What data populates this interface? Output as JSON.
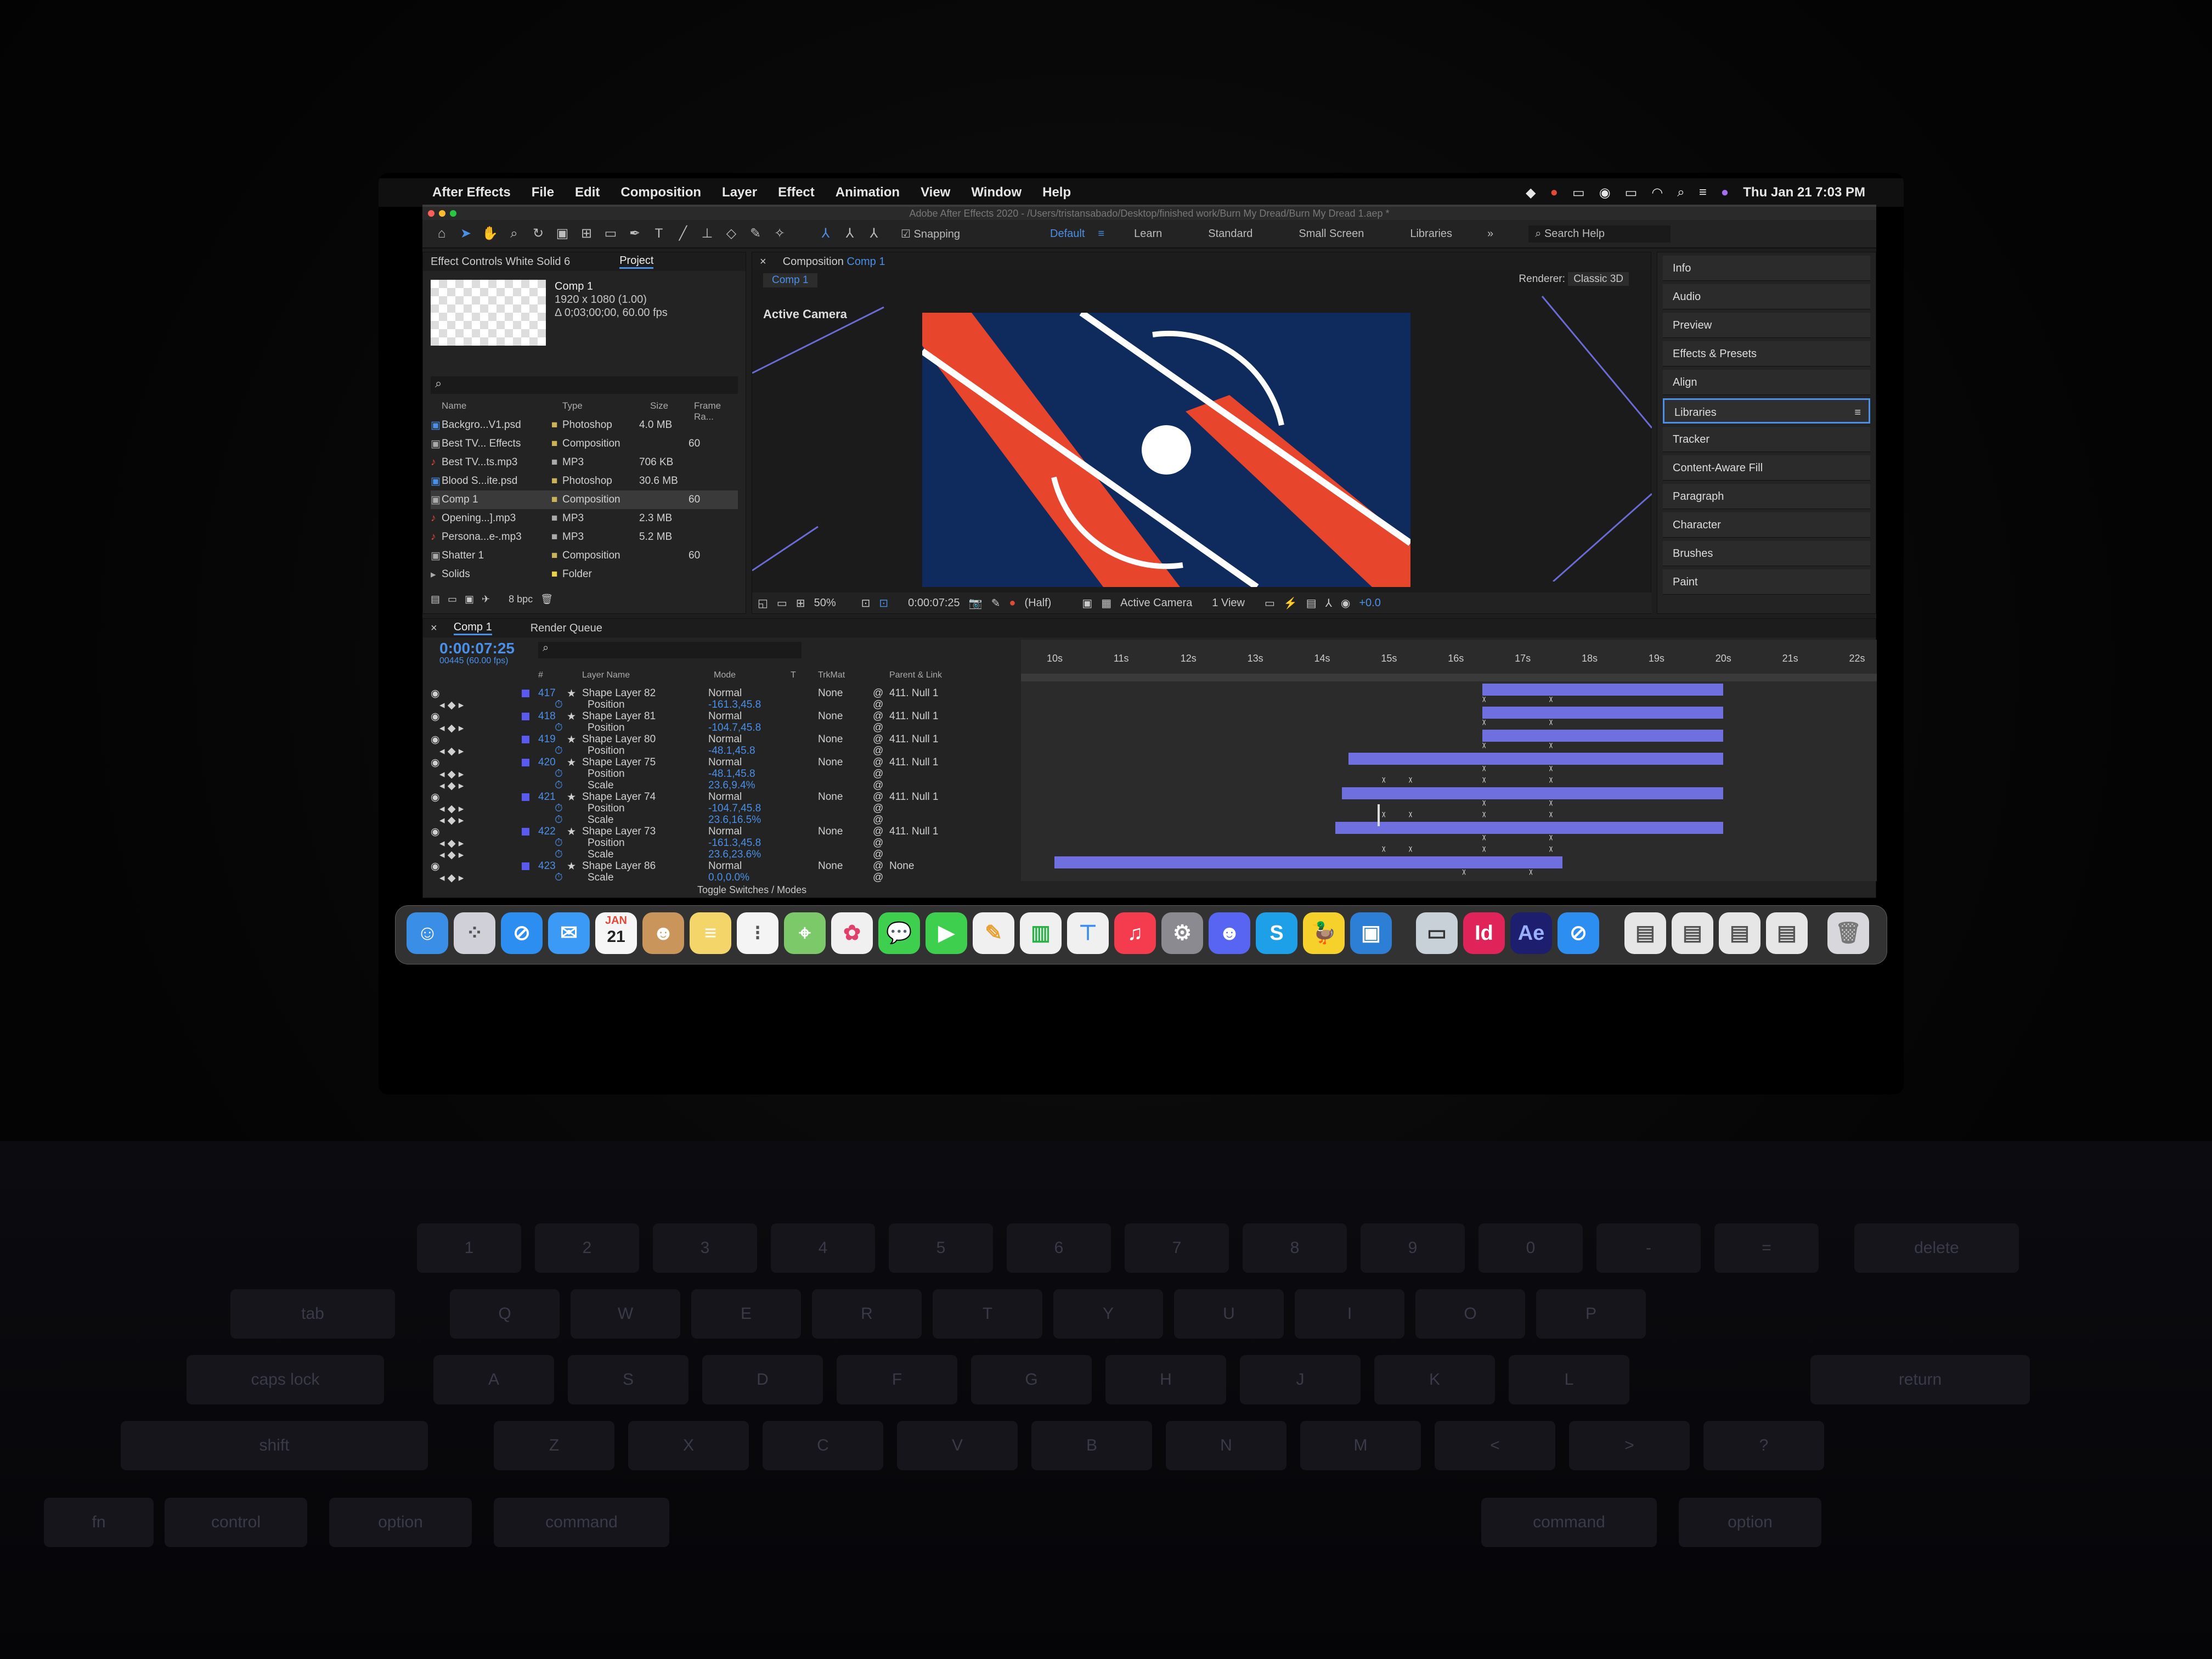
{
  "menubar": {
    "apple": "",
    "app": "After Effects",
    "items": [
      "File",
      "Edit",
      "Composition",
      "Layer",
      "Effect",
      "Animation",
      "View",
      "Window",
      "Help"
    ],
    "clock": "Thu Jan 21  7:03 PM"
  },
  "window": {
    "title": "Adobe After Effects 2020 - /Users/tristansabado/Desktop/finished work/Burn My Dread/Burn My Dread 1.aep *"
  },
  "toolbar": {
    "snapping": "Snapping",
    "workspaces": [
      "Default",
      "Learn",
      "Standard",
      "Small Screen",
      "Libraries"
    ],
    "active_workspace": "Default",
    "search_help": "Search Help"
  },
  "project_panel": {
    "tab_effect_controls": "Effect Controls White Solid 6",
    "tab_project": "Project",
    "comp_name": "Comp 1",
    "comp_info1": "1920 x 1080 (1.00)",
    "comp_info2": "Δ 0;03;00;00, 60.00 fps",
    "columns": {
      "name": "Name",
      "type": "Type",
      "size": "Size",
      "frame": "Frame Ra..."
    },
    "items": [
      {
        "name": "Backgro...V1.psd",
        "type": "Photoshop",
        "size": "4.0 MB",
        "frame": ""
      },
      {
        "name": "Best TV... Effects",
        "type": "Composition",
        "size": "",
        "frame": "60"
      },
      {
        "name": "Best TV...ts.mp3",
        "type": "MP3",
        "size": "706 KB",
        "frame": ""
      },
      {
        "name": "Blood S...ite.psd",
        "type": "Photoshop",
        "size": "30.6 MB",
        "frame": ""
      },
      {
        "name": "Comp 1",
        "type": "Composition",
        "size": "",
        "frame": "60"
      },
      {
        "name": "Opening...].mp3",
        "type": "MP3",
        "size": "2.3 MB",
        "frame": ""
      },
      {
        "name": "Persona...e-.mp3",
        "type": "MP3",
        "size": "5.2 MB",
        "frame": ""
      },
      {
        "name": "Shatter 1",
        "type": "Composition",
        "size": "",
        "frame": "60"
      },
      {
        "name": "Solids",
        "type": "Folder",
        "size": "",
        "frame": ""
      }
    ],
    "bpc": "8 bpc"
  },
  "comp_panel": {
    "tab": "Composition",
    "tab_comp": "Comp 1",
    "breadcrumb": "Comp 1",
    "renderer_label": "Renderer:",
    "renderer": "Classic 3D",
    "active_camera": "Active Camera",
    "zoom": "50%",
    "time": "0:00:07:25",
    "resolution": "(Half)",
    "camera": "Active Camera",
    "views": "1 View",
    "exposure": "+0.0",
    "colors": {
      "bg": "#0f2a5c",
      "red": "#e8452d",
      "white": "#ffffff"
    }
  },
  "right_panel": {
    "items": [
      "Info",
      "Audio",
      "Preview",
      "Effects & Presets",
      "Align",
      "Libraries",
      "Tracker",
      "Content-Aware Fill",
      "Paragraph",
      "Character",
      "Brushes",
      "Paint"
    ],
    "selected": "Libraries"
  },
  "timeline": {
    "tab": "Comp 1",
    "tab2": "Render Queue",
    "timecode": "0:00:07:25",
    "frames": "00445 (60.00 fps)",
    "columns": {
      "num": "#",
      "layer": "Layer Name",
      "mode": "Mode",
      "t": "T",
      "trkmat": "TrkMat",
      "parent": "Parent & Link"
    },
    "ruler": [
      "10s",
      "11s",
      "12s",
      "13s",
      "14s",
      "15s",
      "16s",
      "17s",
      "18s",
      "19s",
      "20s",
      "21s",
      "22s"
    ],
    "rows": [
      {
        "kind": "layer",
        "num": "417",
        "name": "Shape Layer 82",
        "mode": "Normal",
        "trkmat": "None",
        "parent": "411. Null 1"
      },
      {
        "kind": "prop",
        "name": "Position",
        "value": "-161.3,45.8"
      },
      {
        "kind": "layer",
        "num": "418",
        "name": "Shape Layer 81",
        "mode": "Normal",
        "trkmat": "None",
        "parent": "411. Null 1"
      },
      {
        "kind": "prop",
        "name": "Position",
        "value": "-104.7,45.8"
      },
      {
        "kind": "layer",
        "num": "419",
        "name": "Shape Layer 80",
        "mode": "Normal",
        "trkmat": "None",
        "parent": "411. Null 1"
      },
      {
        "kind": "prop",
        "name": "Position",
        "value": "-48.1,45.8"
      },
      {
        "kind": "layer",
        "num": "420",
        "name": "Shape Layer 75",
        "mode": "Normal",
        "trkmat": "None",
        "parent": "411. Null 1"
      },
      {
        "kind": "prop",
        "name": "Position",
        "value": "-48.1,45.8"
      },
      {
        "kind": "prop",
        "name": "Scale",
        "value": "23.6,9.4%"
      },
      {
        "kind": "layer",
        "num": "421",
        "name": "Shape Layer 74",
        "mode": "Normal",
        "trkmat": "None",
        "parent": "411. Null 1"
      },
      {
        "kind": "prop",
        "name": "Position",
        "value": "-104.7,45.8"
      },
      {
        "kind": "prop",
        "name": "Scale",
        "value": "23.6,16.5%"
      },
      {
        "kind": "layer",
        "num": "422",
        "name": "Shape Layer 73",
        "mode": "Normal",
        "trkmat": "None",
        "parent": "411. Null 1"
      },
      {
        "kind": "prop",
        "name": "Position",
        "value": "-161.3,45.8"
      },
      {
        "kind": "prop",
        "name": "Scale",
        "value": "23.6,23.6%"
      },
      {
        "kind": "layer",
        "num": "423",
        "name": "Shape Layer 86",
        "mode": "Normal",
        "trkmat": "None",
        "parent": "None"
      },
      {
        "kind": "prop",
        "name": "Scale",
        "value": "0.0,0.0%"
      }
    ],
    "toggle": "Toggle Switches / Modes"
  },
  "dock": {
    "apps": [
      "Finder",
      "Launchpad",
      "Safari",
      "Mail",
      "Calendar",
      "Contacts",
      "Notes",
      "Reminders",
      "Maps",
      "Photos",
      "Messages",
      "FaceTime",
      "Freeform",
      "Numbers",
      "Keynote",
      "Music",
      "System Preferences",
      "Discord",
      "Skype",
      "Cyberduck",
      "Screen",
      "Preview",
      "InDesign",
      "After Effects",
      "Safari Tech"
    ],
    "calendar_month": "JAN",
    "calendar_day": "21",
    "id_label": "Id",
    "ae_label": "Ae",
    "s_label": "S"
  },
  "keyboard": {
    "row1": [
      "!",
      "@",
      "#",
      "$",
      "%",
      "^",
      "&",
      "*",
      "(",
      ")",
      "—",
      "+"
    ],
    "row1b": [
      "1",
      "2",
      "3",
      "4",
      "5",
      "6",
      "7",
      "8",
      "9",
      "0",
      "-",
      "="
    ],
    "row2": [
      "Q",
      "W",
      "E",
      "R",
      "T",
      "Y",
      "U",
      "I",
      "O",
      "P"
    ],
    "row3": [
      "A",
      "S",
      "D",
      "F",
      "G",
      "H",
      "J",
      "K",
      "L"
    ],
    "row4": [
      "Z",
      "X",
      "C",
      "V",
      "B",
      "N",
      "M",
      "<",
      ">",
      "?"
    ],
    "mods": [
      "tab",
      "caps lock",
      "shift",
      "fn",
      "control",
      "option",
      "command",
      "command",
      "option"
    ],
    "delete": "delete",
    "return": "return"
  }
}
